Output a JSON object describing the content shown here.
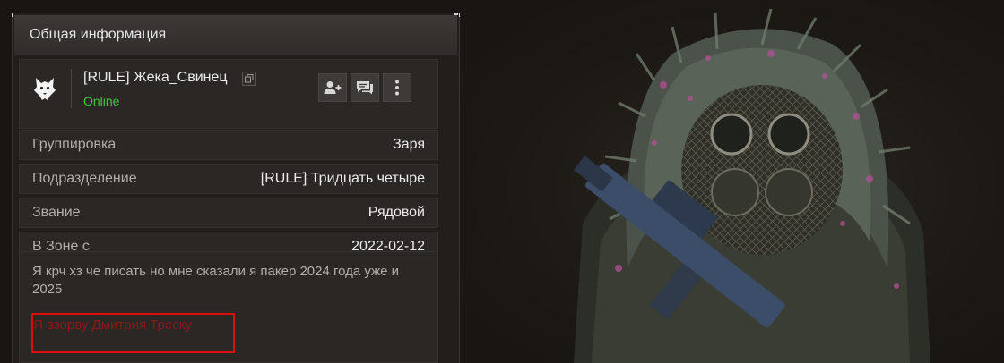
{
  "panel": {
    "title": "Общая информация"
  },
  "profile": {
    "name": "[RULE] Жека_Свинец",
    "status": "Online",
    "status_color": "#3fc83a",
    "emblem_icon": "wolf-head-icon",
    "copy_icon": "copy-icon",
    "actions": [
      {
        "name": "add-friend-button",
        "icon": "add-user-icon"
      },
      {
        "name": "message-button",
        "icon": "chat-icon"
      },
      {
        "name": "more-options-button",
        "icon": "vertical-dots-icon"
      }
    ]
  },
  "info_rows": [
    {
      "label": "Группировка",
      "value": "Заря"
    },
    {
      "label": "Подразделение",
      "value": "[RULE] Тридцать четыре"
    },
    {
      "label": "Звание",
      "value": "Рядовой"
    },
    {
      "label": "В Зоне с",
      "value": "2022-02-12"
    }
  ],
  "bio": {
    "text": "Я крч хз че писать но мне сказали я пакер 2024 года уже и 2025",
    "extra_line": "Я взорву Дмитрия Треску",
    "extra_color": "#8a1a1a",
    "highlight_color": "#e00d0d"
  }
}
